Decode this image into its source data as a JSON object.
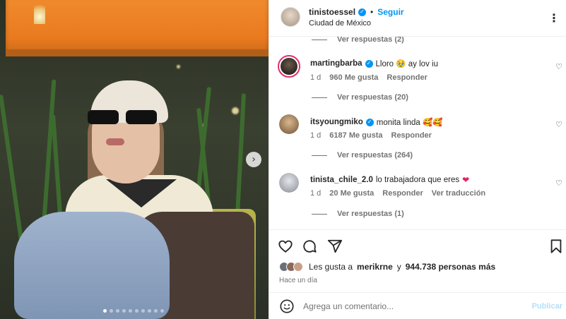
{
  "post": {
    "dots_count": 10,
    "active_dot": 0
  },
  "header": {
    "username": "tinistoessel",
    "separator": "•",
    "follow_label": "Seguir",
    "location": "Ciudad de México",
    "more_glyph": "⋮"
  },
  "top_replies": {
    "label": "Ver respuestas (2)"
  },
  "comments": [
    {
      "username": "martingbarba",
      "verified": true,
      "text": "Lloro 🥹 ay lov iu",
      "age": "1 d",
      "likes": "960 Me gusta",
      "reply_label": "Responder",
      "replies_label": "Ver respuestas (20)"
    },
    {
      "username": "itsyoungmiko",
      "verified": true,
      "text": "monita linda 🥰🥰",
      "age": "1 d",
      "likes": "6187 Me gusta",
      "reply_label": "Responder",
      "replies_label": "Ver respuestas (264)"
    },
    {
      "username": "tinista_chile_2.0",
      "verified": false,
      "text": "lo trabajadora que eres",
      "age": "1 d",
      "likes": "20 Me gusta",
      "reply_label": "Responder",
      "translate_label": "Ver traducción",
      "replies_label": "Ver respuestas (1)"
    }
  ],
  "likes": {
    "prefix": "Les gusta a",
    "user": "merikrne",
    "conjunction": "y",
    "count": "944.738 personas más"
  },
  "time_ago": "Hace un día",
  "add_comment": {
    "placeholder": "Agrega un comentario...",
    "post_label": "Publicar"
  },
  "colors": {
    "accent": "#0095f6",
    "heart": "#e0245e"
  }
}
